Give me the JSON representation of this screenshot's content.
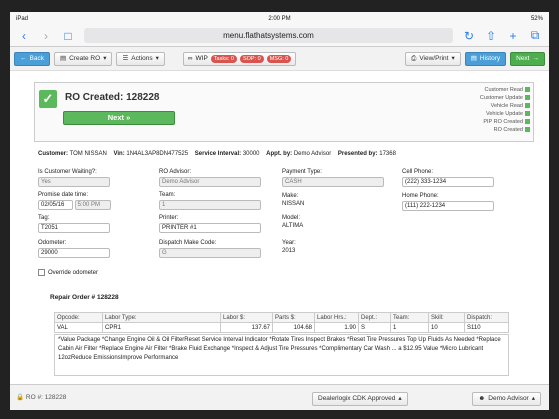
{
  "status_bar": {
    "device": "iPad",
    "time": "2:00 PM",
    "battery": "52%"
  },
  "browser": {
    "url": "menu.flathatsystems.com"
  },
  "toolbar": {
    "back_label": "Back",
    "create_ro_label": "Create RO",
    "actions_label": "Actions",
    "wip_label": "WIP",
    "tasks_badge": "Tasks: 0",
    "sop_badge": "SOP: 0",
    "msg_badge": "MSG: 0",
    "view_print_label": "View/Print",
    "history_label": "History",
    "next_label": "Next"
  },
  "banner": {
    "title": "RO Created: 128228",
    "next_label": "Next »",
    "checks": [
      "Customer Read",
      "Customer Update",
      "Vehicle Read",
      "Vehicle Update",
      "PIP RO Created",
      "RO Created"
    ]
  },
  "info": {
    "customer_label": "Customer:",
    "customer": "TOM NISSAN",
    "vin_label": "Vin:",
    "vin": "1N4AL3AP8DN477525",
    "interval_label": "Service Interval:",
    "interval": "30000",
    "appt_label": "Appt. by:",
    "appt": "Demo Advisor",
    "presented_label": "Presented by:",
    "presented": "17368"
  },
  "form": {
    "waiting_label": "Is Customer Waiting?:",
    "waiting_value": "Yes",
    "promise_label": "Promise date time:",
    "promise_date": "02/05/16",
    "promise_time": "5:00 PM",
    "tag_label": "Tag:",
    "tag_value": "T2051",
    "odometer_label": "Odometer:",
    "odometer_value": "29000",
    "override_label": "Override odometer",
    "advisor_label": "RO Advisor:",
    "advisor_value": "Demo Advisor",
    "team_label": "Team:",
    "team_value": "1",
    "printer_label": "Printer:",
    "printer_value": "PRINTER #1",
    "dispatch_label": "Dispatch Make Code:",
    "dispatch_value": "G",
    "payment_label": "Payment Type:",
    "payment_value": "CASH",
    "make_label": "Make:",
    "make_value": "NISSAN",
    "model_label": "Model:",
    "model_value": "ALTIMA",
    "year_label": "Year:",
    "year_value": "2013",
    "cell_label": "Cell Phone:",
    "cell_value": "(222) 333-1234",
    "home_label": "Home Phone:",
    "home_value": "(111) 222-1234"
  },
  "repair_order": {
    "title": "Repair Order # 128228",
    "headers": [
      "Opcode:",
      "Labor Type:",
      "Labor $:",
      "Parts $:",
      "Labor Hrs.:",
      "Dept.:",
      "Team:",
      "Skill:",
      "Dispatch:"
    ],
    "row": [
      "VAL",
      "CPR1",
      "137.67",
      "104.68",
      "1.90",
      "S",
      "1",
      "10",
      "S110"
    ],
    "description": "*Value Package *Change Engine Oil & Oil FilterReset Service Interval Indicator *Rotate Tires Inspect Brakes *Reset Tire Pressures Top Up Fluids As Needed *Replace Cabin Air Filter *Replace Engine Air Filter *Brake Fluid Exchange *Inspect & Adjust Tire Pressures *Complimentary Car Wash ... a $12.95 Value *Micro Lubricant 12ozReduce EmissionsImprove Performance"
  },
  "footer": {
    "ro_label": "RO #: 128228",
    "dms_label": "Dealerlogix CDK Approved",
    "advisor_label": "Demo Advisor"
  }
}
